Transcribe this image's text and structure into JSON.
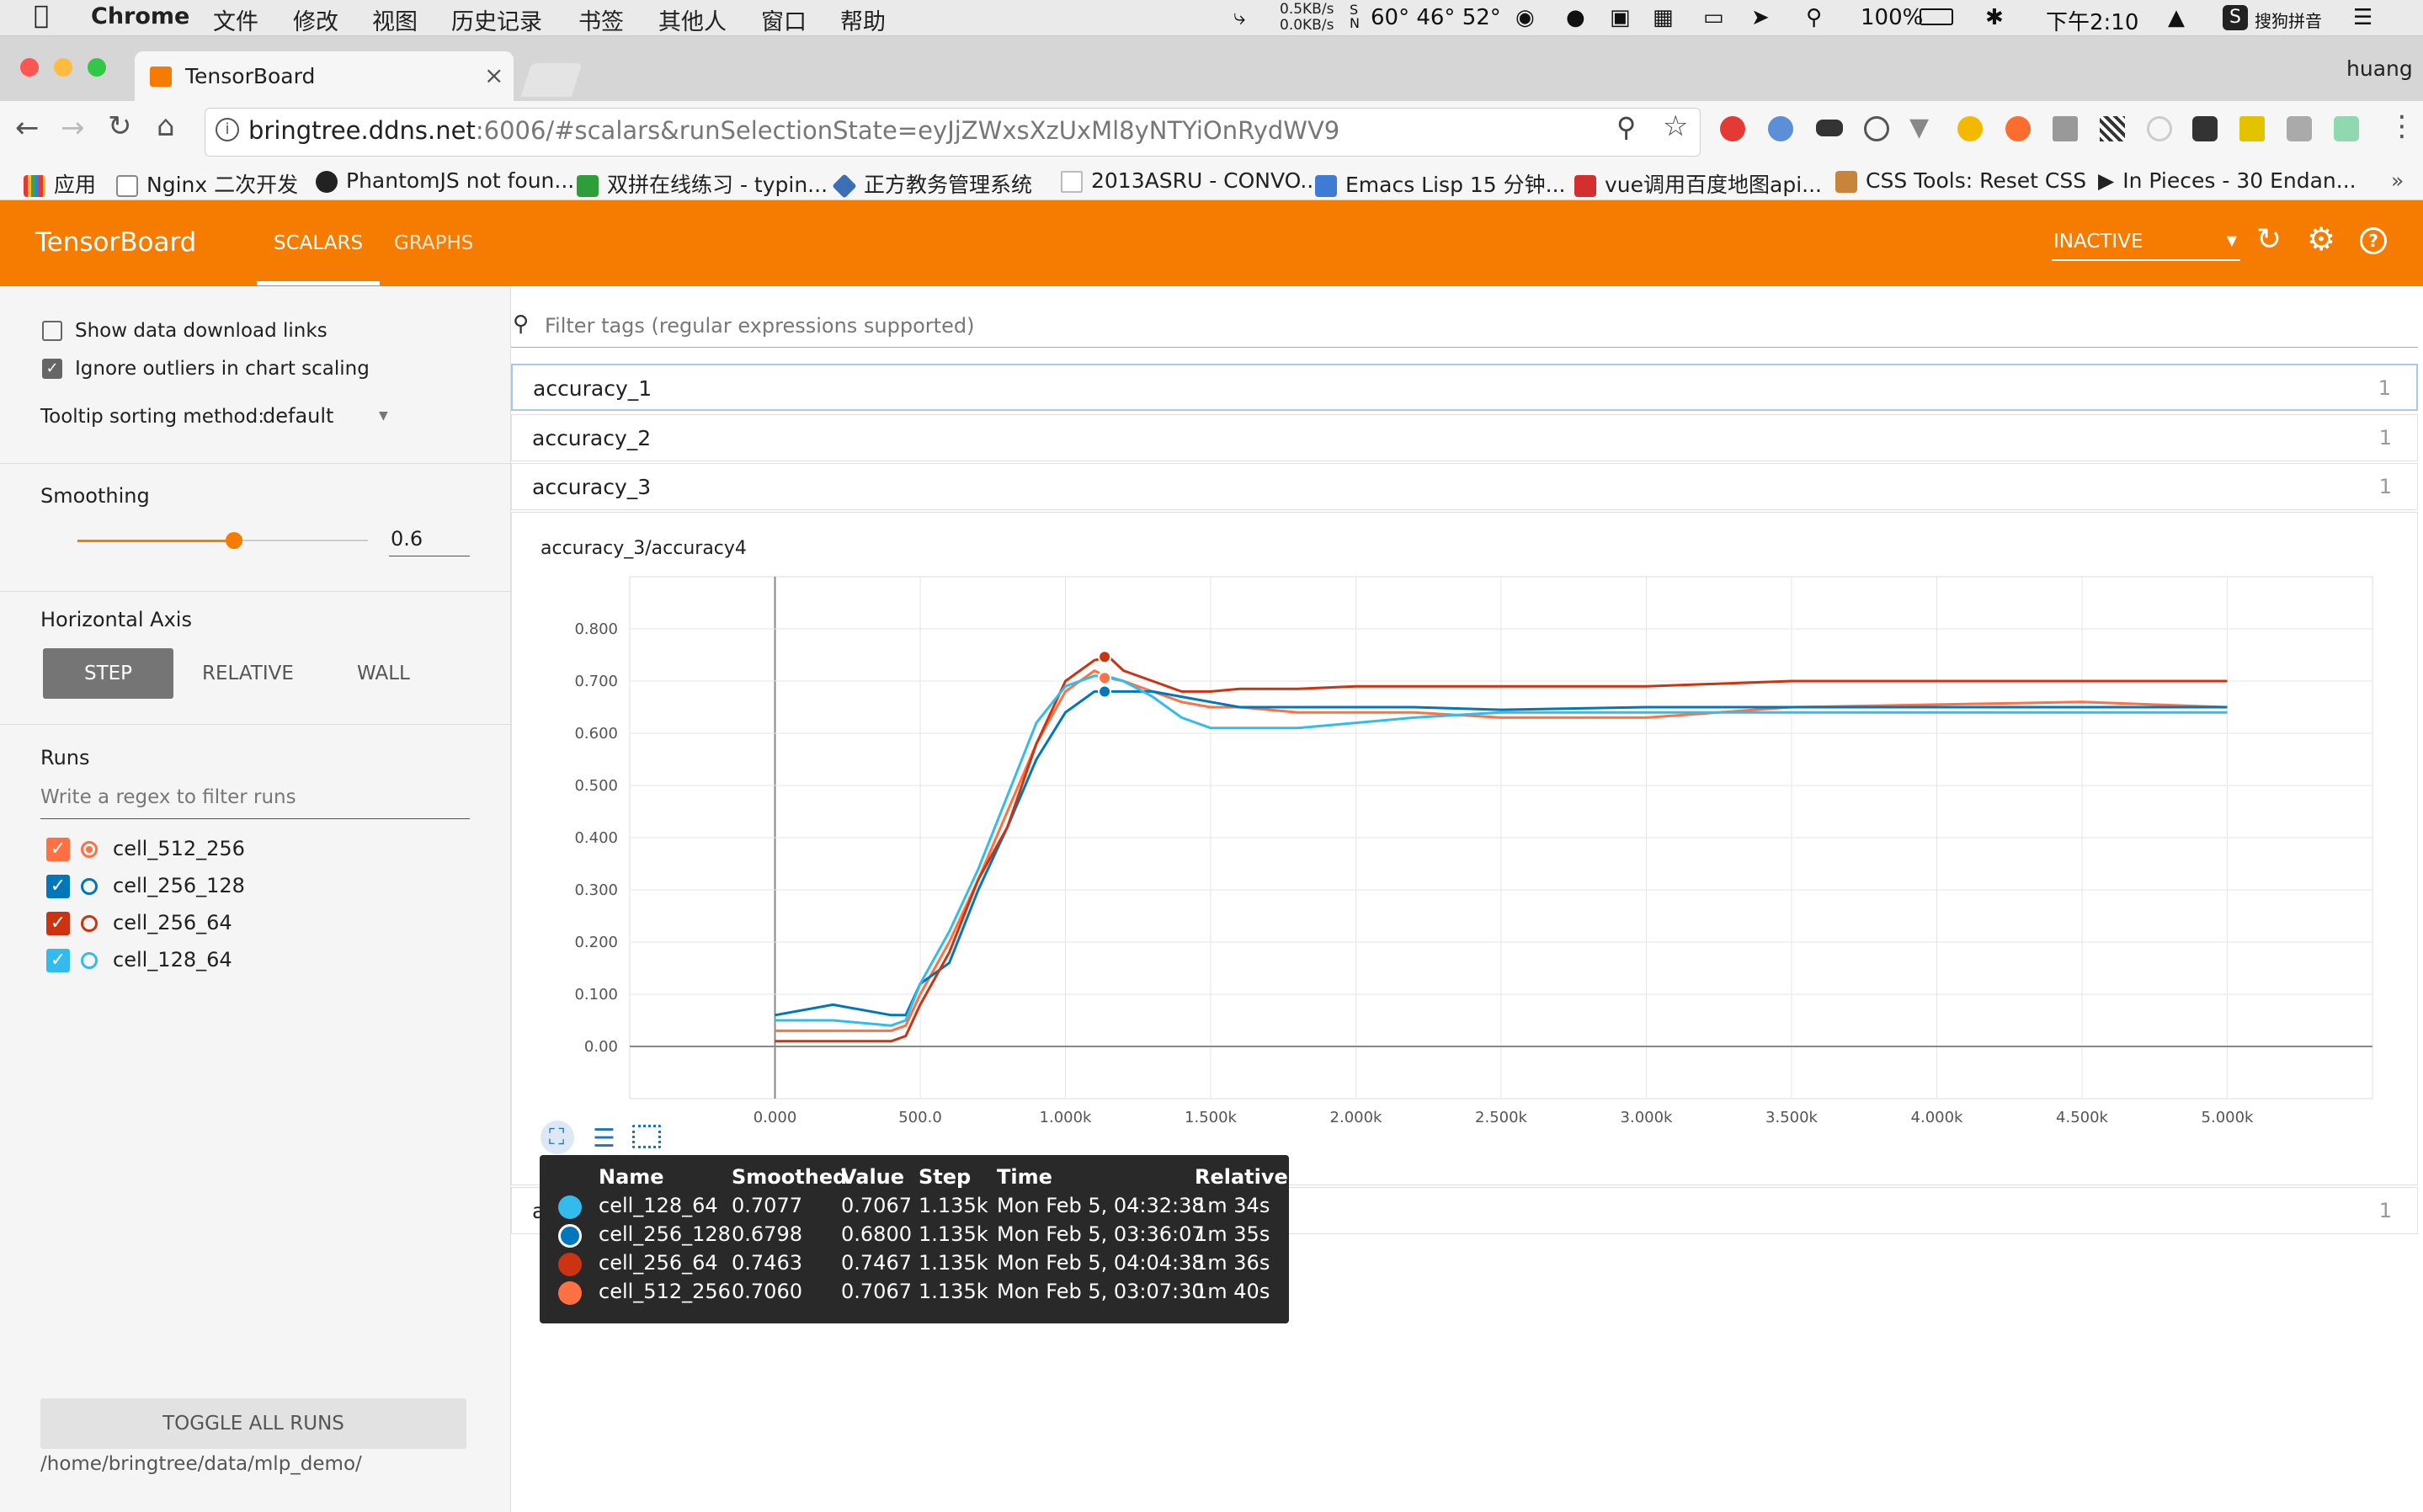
{
  "menubar": {
    "items": [
      "Chrome",
      "文件",
      "修改",
      "视图",
      "历史记录",
      "书签",
      "其他人",
      "窗口",
      "帮助"
    ],
    "net_up": "0.5KB/s",
    "net_down": "0.0KB/s",
    "temps": "60° 46° 52°",
    "battery": "100%",
    "clock": "下午2:10",
    "ime": "搜狗拼音"
  },
  "browser": {
    "tab_title": "TensorBoard",
    "user": "huang",
    "url_host": "bringtree.ddns.net",
    "url_rest": ":6006/#scalars&runSelectionState=eyJjZWxsXzUxMl8yNTYiOnRydWV9"
  },
  "bookmarks": [
    {
      "label": "应用",
      "color": "#4a90d9"
    },
    {
      "label": "Nginx 二次开发",
      "color": "#888888"
    },
    {
      "label": "PhantomJS not foun...",
      "color": "#222222"
    },
    {
      "label": "双拼在线练习 - typin...",
      "color": "#2e9e3a"
    },
    {
      "label": "正方教务管理系统",
      "color": "#3b6fb6"
    },
    {
      "label": "2013ASRU - CONVO...",
      "color": "#bbbbbb"
    },
    {
      "label": "Emacs Lisp 15 分钟...",
      "color": "#3d7bd4"
    },
    {
      "label": "vue调用百度地图api...",
      "color": "#d32f2f"
    },
    {
      "label": "CSS Tools: Reset CSS",
      "color": "#c8843a"
    },
    {
      "label": "In Pieces - 30 Endan...",
      "color": "#222222"
    }
  ],
  "header": {
    "title": "TensorBoard",
    "tabs": [
      "SCALARS",
      "GRAPHS"
    ],
    "status": "INACTIVE",
    "color": "#f57c00"
  },
  "sidebar": {
    "show_download": "Show data download links",
    "ignore_outliers": "Ignore outliers in chart scaling",
    "tooltip_sort_label": "Tooltip sorting method:",
    "tooltip_sort_value": "default",
    "smoothing_label": "Smoothing",
    "smoothing_value": "0.6",
    "smoothing_fraction": 0.6,
    "haxis_label": "Horizontal Axis",
    "haxis_options": [
      "STEP",
      "RELATIVE",
      "WALL"
    ],
    "runs_label": "Runs",
    "runs_filter_placeholder": "Write a regex to filter runs",
    "runs": [
      {
        "name": "cell_512_256",
        "color": "#ff7043",
        "checked": true,
        "selected": true
      },
      {
        "name": "cell_256_128",
        "color": "#0077bb",
        "checked": true,
        "selected": false
      },
      {
        "name": "cell_256_64",
        "color": "#cc3311",
        "checked": true,
        "selected": false
      },
      {
        "name": "cell_128_64",
        "color": "#33bbee",
        "checked": true,
        "selected": false
      }
    ],
    "toggle_all": "TOGGLE ALL RUNS",
    "logdir": "/home/bringtree/data/mlp_demo/"
  },
  "main": {
    "filter_placeholder": "Filter tags (regular expressions supported)",
    "tags": [
      {
        "name": "accuracy_1",
        "count": "1"
      },
      {
        "name": "accuracy_2",
        "count": "1"
      },
      {
        "name": "accuracy_3",
        "count": "1"
      },
      {
        "name": "acc",
        "count": "1"
      }
    ],
    "chart_title": "accuracy_3/accuracy4"
  },
  "chart_data": {
    "type": "line",
    "title": "accuracy_3/accuracy4",
    "xlim": [
      -500,
      5500
    ],
    "ylim": [
      -0.1,
      0.9
    ],
    "x_ticks": [
      "0.000",
      "500.0",
      "1.000k",
      "1.500k",
      "2.000k",
      "2.500k",
      "3.000k",
      "3.500k",
      "4.000k",
      "4.500k",
      "5.000k"
    ],
    "y_ticks": [
      "0.00",
      "0.100",
      "0.200",
      "0.300",
      "0.400",
      "0.500",
      "0.600",
      "0.700",
      "0.800"
    ],
    "grid": true,
    "series": [
      {
        "name": "cell_512_256",
        "color": "#ff7043",
        "x": [
          0,
          200,
          400,
          450,
          500,
          600,
          700,
          800,
          900,
          1000,
          1100,
          1150,
          1200,
          1300,
          1400,
          1500,
          1600,
          1800,
          2000,
          2200,
          2500,
          3000,
          3500,
          4000,
          4500,
          5000
        ],
        "y": [
          0.03,
          0.03,
          0.03,
          0.04,
          0.1,
          0.2,
          0.32,
          0.45,
          0.58,
          0.68,
          0.72,
          0.706,
          0.7,
          0.68,
          0.66,
          0.65,
          0.65,
          0.64,
          0.64,
          0.64,
          0.63,
          0.63,
          0.65,
          0.655,
          0.66,
          0.65
        ]
      },
      {
        "name": "cell_256_128",
        "color": "#0077bb",
        "x": [
          0,
          200,
          400,
          450,
          500,
          600,
          700,
          800,
          900,
          1000,
          1100,
          1150,
          1200,
          1300,
          1400,
          1500,
          1600,
          1800,
          2000,
          2200,
          2500,
          3000,
          3500,
          4000,
          4500,
          5000
        ],
        "y": [
          0.06,
          0.08,
          0.06,
          0.06,
          0.12,
          0.16,
          0.3,
          0.42,
          0.55,
          0.64,
          0.68,
          0.68,
          0.68,
          0.68,
          0.67,
          0.66,
          0.65,
          0.65,
          0.65,
          0.65,
          0.645,
          0.65,
          0.65,
          0.65,
          0.65,
          0.65
        ]
      },
      {
        "name": "cell_256_64",
        "color": "#cc3311",
        "x": [
          0,
          200,
          400,
          450,
          500,
          600,
          700,
          800,
          900,
          1000,
          1100,
          1150,
          1200,
          1300,
          1400,
          1500,
          1600,
          1800,
          2000,
          2200,
          2500,
          3000,
          3500,
          4000,
          4500,
          5000
        ],
        "y": [
          0.01,
          0.01,
          0.01,
          0.02,
          0.08,
          0.18,
          0.32,
          0.42,
          0.58,
          0.7,
          0.74,
          0.746,
          0.72,
          0.7,
          0.68,
          0.68,
          0.685,
          0.685,
          0.69,
          0.69,
          0.69,
          0.69,
          0.7,
          0.7,
          0.7,
          0.7
        ]
      },
      {
        "name": "cell_128_64",
        "color": "#33bbee",
        "x": [
          0,
          200,
          400,
          450,
          500,
          600,
          700,
          800,
          900,
          1000,
          1100,
          1150,
          1200,
          1300,
          1400,
          1500,
          1600,
          1800,
          2000,
          2200,
          2500,
          3000,
          3500,
          4000,
          4500,
          5000
        ],
        "y": [
          0.05,
          0.05,
          0.04,
          0.05,
          0.12,
          0.22,
          0.34,
          0.48,
          0.62,
          0.69,
          0.71,
          0.708,
          0.7,
          0.67,
          0.63,
          0.61,
          0.61,
          0.61,
          0.62,
          0.63,
          0.64,
          0.64,
          0.64,
          0.64,
          0.64,
          0.64
        ]
      }
    ]
  },
  "tooltip": {
    "columns": [
      "Name",
      "Smoothed",
      "Value",
      "Step",
      "Time",
      "Relative"
    ],
    "rows": [
      {
        "color": "#33bbee",
        "name": "cell_128_64",
        "smoothed": "0.7077",
        "value": "0.7067",
        "step": "1.135k",
        "time": "Mon Feb 5, 04:32:38",
        "relative": "1m 34s"
      },
      {
        "color": "#0077bb",
        "name": "cell_256_128",
        "smoothed": "0.6798",
        "value": "0.6800",
        "step": "1.135k",
        "time": "Mon Feb 5, 03:36:07",
        "relative": "1m 35s"
      },
      {
        "color": "#cc3311",
        "name": "cell_256_64",
        "smoothed": "0.7463",
        "value": "0.7467",
        "step": "1.135k",
        "time": "Mon Feb 5, 04:04:38",
        "relative": "1m 36s"
      },
      {
        "color": "#ff7043",
        "name": "cell_512_256",
        "smoothed": "0.7060",
        "value": "0.7067",
        "step": "1.135k",
        "time": "Mon Feb 5, 03:07:30",
        "relative": "1m 40s"
      }
    ]
  }
}
